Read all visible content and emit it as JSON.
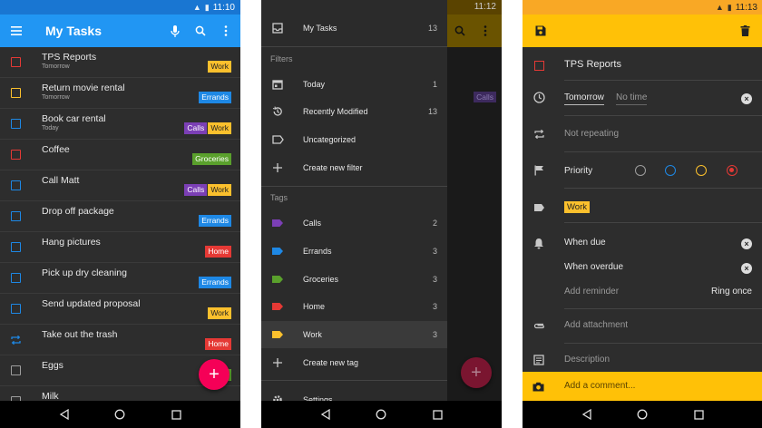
{
  "phone1": {
    "status_time": "11:10",
    "title": "My Tasks",
    "tasks": [
      {
        "name": "TPS Reports",
        "due": "Tomorrow",
        "check_color": "#e53935",
        "tags": [
          {
            "label": "Work",
            "bg": "#fbc02d",
            "fg": "#222"
          }
        ]
      },
      {
        "name": "Return movie rental",
        "due": "Tomorrow",
        "check_color": "#fbc02d",
        "tags": [
          {
            "label": "Errands",
            "bg": "#1e88e5",
            "fg": "#fff"
          }
        ]
      },
      {
        "name": "Book car rental",
        "due": "Today",
        "check_color": "#1e88e5",
        "tags": [
          {
            "label": "Calls",
            "bg": "#7b3fb5",
            "fg": "#fff"
          },
          {
            "label": "Work",
            "bg": "#fbc02d",
            "fg": "#222"
          }
        ]
      },
      {
        "name": "Coffee",
        "due": "",
        "check_color": "#e53935",
        "tags": [
          {
            "label": "Groceries",
            "bg": "#5aa02c",
            "fg": "#fff"
          }
        ]
      },
      {
        "name": "Call Matt",
        "due": "",
        "check_color": "#1e88e5",
        "tags": [
          {
            "label": "Calls",
            "bg": "#7b3fb5",
            "fg": "#fff"
          },
          {
            "label": "Work",
            "bg": "#fbc02d",
            "fg": "#222"
          }
        ]
      },
      {
        "name": "Drop off package",
        "due": "",
        "check_color": "#1e88e5",
        "tags": [
          {
            "label": "Errands",
            "bg": "#1e88e5",
            "fg": "#fff"
          }
        ]
      },
      {
        "name": "Hang pictures",
        "due": "",
        "check_color": "#1e88e5",
        "tags": [
          {
            "label": "Home",
            "bg": "#e53935",
            "fg": "#fff"
          }
        ]
      },
      {
        "name": "Pick up dry cleaning",
        "due": "",
        "check_color": "#1e88e5",
        "tags": [
          {
            "label": "Errands",
            "bg": "#1e88e5",
            "fg": "#fff"
          }
        ]
      },
      {
        "name": "Send updated proposal",
        "due": "",
        "check_color": "#1e88e5",
        "tags": [
          {
            "label": "Work",
            "bg": "#fbc02d",
            "fg": "#222"
          }
        ]
      },
      {
        "name": "Take out the trash",
        "due": "",
        "check_color": "#1e88e5",
        "repeat": true,
        "tags": [
          {
            "label": "Home",
            "bg": "#e53935",
            "fg": "#fff"
          }
        ]
      },
      {
        "name": "Eggs",
        "due": "",
        "check_color": "#9e9e9e",
        "tags": [
          {
            "label": "Gr",
            "bg": "#5aa02c",
            "fg": "#fff"
          }
        ]
      },
      {
        "name": "Milk",
        "due": "",
        "check_color": "#9e9e9e",
        "tags": []
      }
    ],
    "fab_icon": "+"
  },
  "phone2": {
    "status_time": "11:12",
    "under_tag": "Calls",
    "fab_icon": "+",
    "my_tasks": {
      "label": "My Tasks",
      "count": "13"
    },
    "filters_header": "Filters",
    "filters": [
      {
        "label": "Today",
        "count": "1",
        "icon": "calendar-icon"
      },
      {
        "label": "Recently Modified",
        "count": "13",
        "icon": "history-icon"
      },
      {
        "label": "Uncategorized",
        "count": "",
        "icon": "label-outline-icon"
      },
      {
        "label": "Create new filter",
        "count": "",
        "icon": "plus-icon"
      }
    ],
    "tags_header": "Tags",
    "tags": [
      {
        "label": "Calls",
        "count": "2",
        "color": "#7b3fb5"
      },
      {
        "label": "Errands",
        "count": "3",
        "color": "#1e88e5"
      },
      {
        "label": "Groceries",
        "count": "3",
        "color": "#5aa02c"
      },
      {
        "label": "Home",
        "count": "3",
        "color": "#e53935"
      },
      {
        "label": "Work",
        "count": "3",
        "color": "#fbc02d"
      }
    ],
    "create_tag": "Create new tag",
    "settings": "Settings"
  },
  "phone3": {
    "status_time": "11:13",
    "task_title": "TPS Reports",
    "due_date": "Tomorrow",
    "due_time": "No time",
    "repeat": "Not repeating",
    "priority_label": "Priority",
    "priority_colors": [
      "#9e9e9e",
      "#1e88e5",
      "#fbc02d",
      "#e53935"
    ],
    "tag": "Work",
    "reminder_due": "When due",
    "reminder_overdue": "When overdue",
    "add_reminder": "Add reminder",
    "ring": "Ring once",
    "attachment": "Add attachment",
    "description": "Description",
    "comment": "Add a comment..."
  }
}
